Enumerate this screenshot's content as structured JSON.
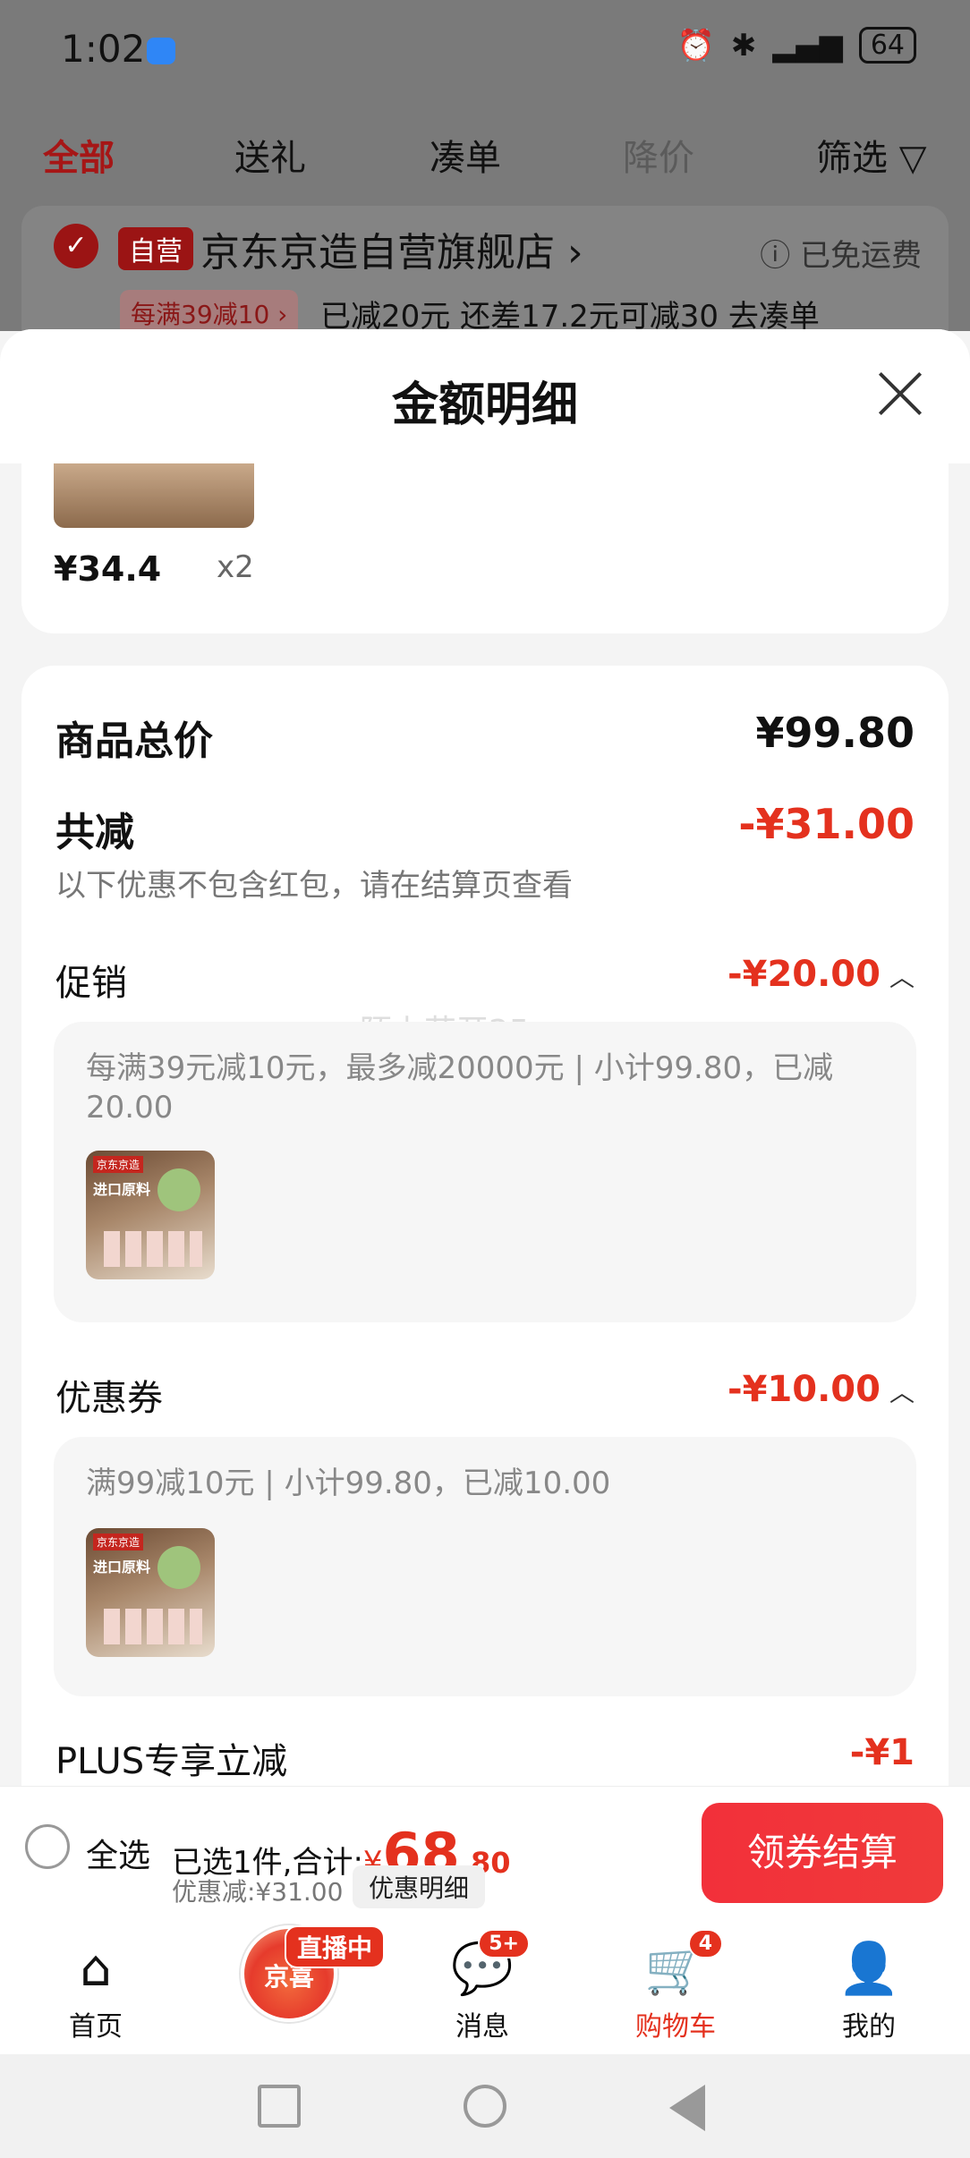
{
  "status_bar": {
    "time": "1:02",
    "battery": "64"
  },
  "tabs": [
    {
      "label": "全部"
    },
    {
      "label": "送礼"
    },
    {
      "label": "凑单"
    },
    {
      "label": "降价"
    },
    {
      "label": "筛选"
    }
  ],
  "store": {
    "self_badge": "自营",
    "name": "京东京造自营旗舰店",
    "free_shipping": "已免运费",
    "promo_pill": "每满39减10",
    "promo_text": "已减20元  还差17.2元可减30  去凑单"
  },
  "sheet": {
    "title": "金额明细",
    "item": {
      "price": "¥34.4",
      "qty": "x2"
    },
    "total_label": "商品总价",
    "total_value": "¥99.80",
    "reduce_label": "共减",
    "reduce_value": "-¥31.00",
    "reduce_note": "以下优惠不包含红包，请在结算页查看",
    "watermark": "陌上花开25",
    "promo": {
      "label": "促销",
      "value": "-¥20.00",
      "detail": "每满39元减10元，最多减20000元 | 小计99.80，已减20.00"
    },
    "coupon": {
      "label": "优惠券",
      "value": "-¥10.00",
      "detail": "满99减10元 | 小计99.80，已减10.00"
    },
    "plus": {
      "label": "PLUS专享立减",
      "value": "-¥1"
    },
    "thumb_tag": "京东京造",
    "thumb_text": "进口原料"
  },
  "bottom_bar": {
    "select_all": "全选",
    "selected_prefix": "已选1件,合计:",
    "currency": "¥",
    "total_int": "68",
    "total_dec": ".80",
    "discount": "优惠减:¥31.00",
    "detail_button": "优惠明细",
    "checkout_button": "领券结算"
  },
  "nav": [
    {
      "label": "首页",
      "icon": "home-icon"
    },
    {
      "label": "京喜",
      "icon": "live-icon",
      "badge": "直播中"
    },
    {
      "label": "消息",
      "icon": "message-icon",
      "badge": "5+"
    },
    {
      "label": "购物车",
      "icon": "cart-icon",
      "badge": "4"
    },
    {
      "label": "我的",
      "icon": "profile-icon"
    }
  ],
  "colors": {
    "accent": "#e4311e",
    "checkout": "#f2303a",
    "overlay": "#7a7a7a"
  }
}
